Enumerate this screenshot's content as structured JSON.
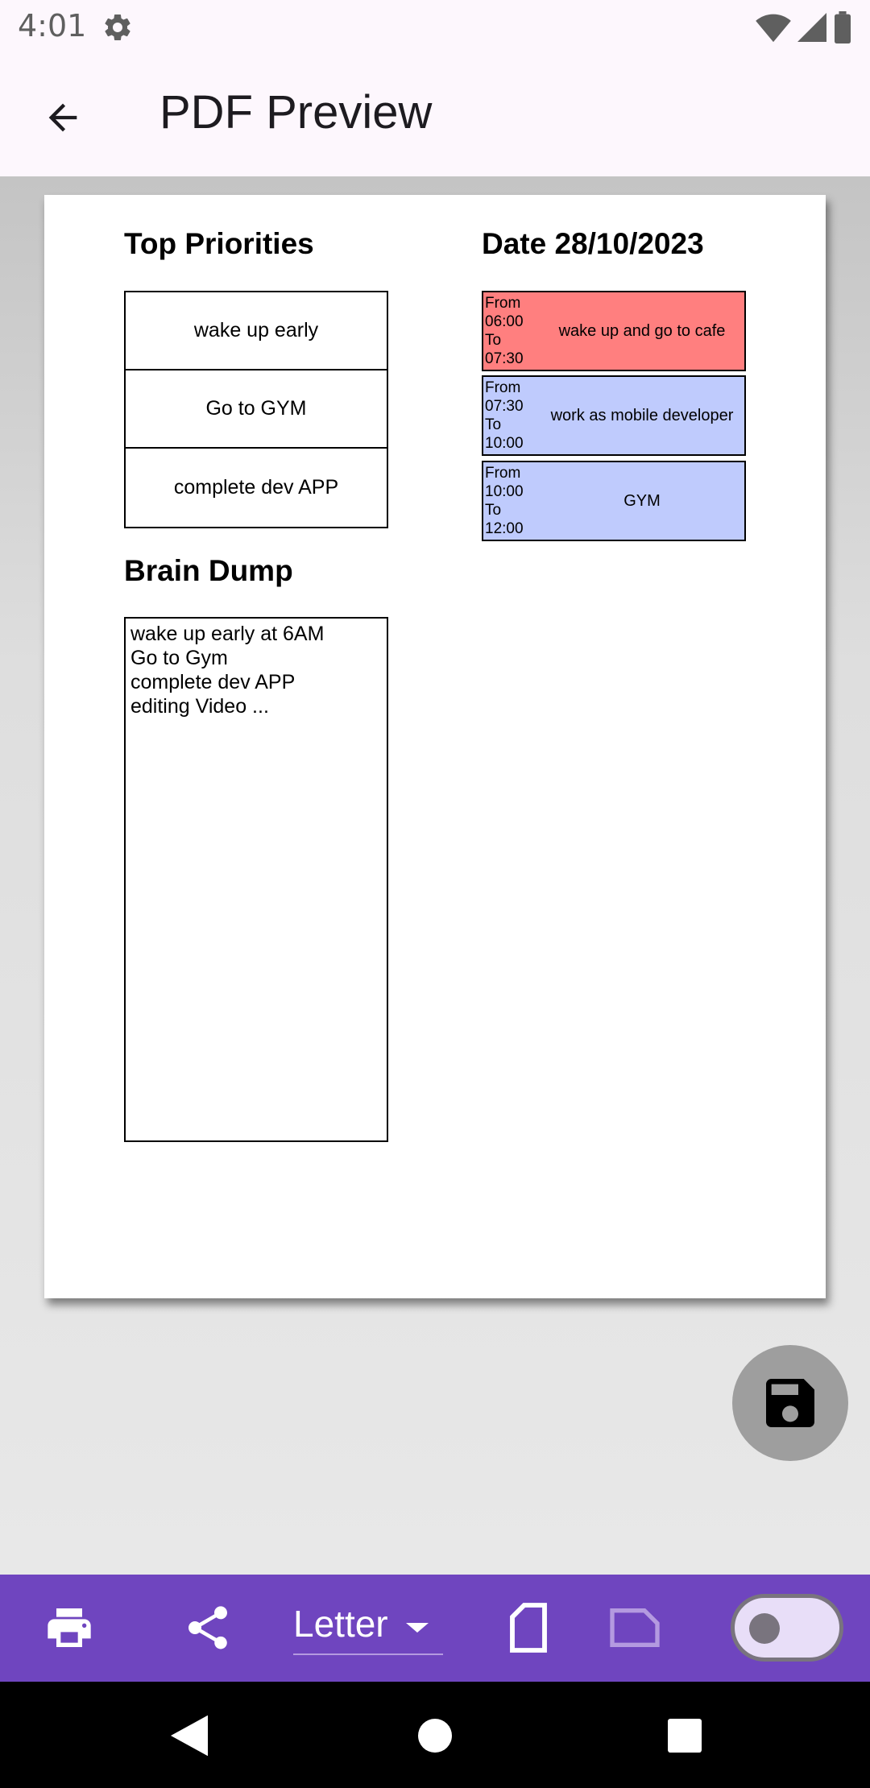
{
  "status_bar": {
    "time": "4:01"
  },
  "app_bar": {
    "title": "PDF Preview"
  },
  "document": {
    "priorities_heading": "Top Priorities",
    "priorities": [
      "wake up early",
      "Go to GYM",
      "complete dev APP"
    ],
    "brain_dump_heading": "Brain Dump",
    "brain_dump_text": "wake up early at 6AM\nGo to Gym\ncomplete dev APP\nediting Video ...",
    "date_heading": "Date 28/10/2023",
    "schedule": [
      {
        "time": "From\n06:00\nTo\n07:30",
        "task": "wake up and go to cafe",
        "color": "#ff7f7f"
      },
      {
        "time": "From\n07:30\nTo\n10:00",
        "task": "work as mobile developer",
        "color": "#bfcbfd"
      },
      {
        "time": "From\n10:00\nTo\n12:00",
        "task": "GYM",
        "color": "#bfcbfd"
      }
    ]
  },
  "toolbar": {
    "page_size": "Letter",
    "color": "#6f45bf"
  }
}
